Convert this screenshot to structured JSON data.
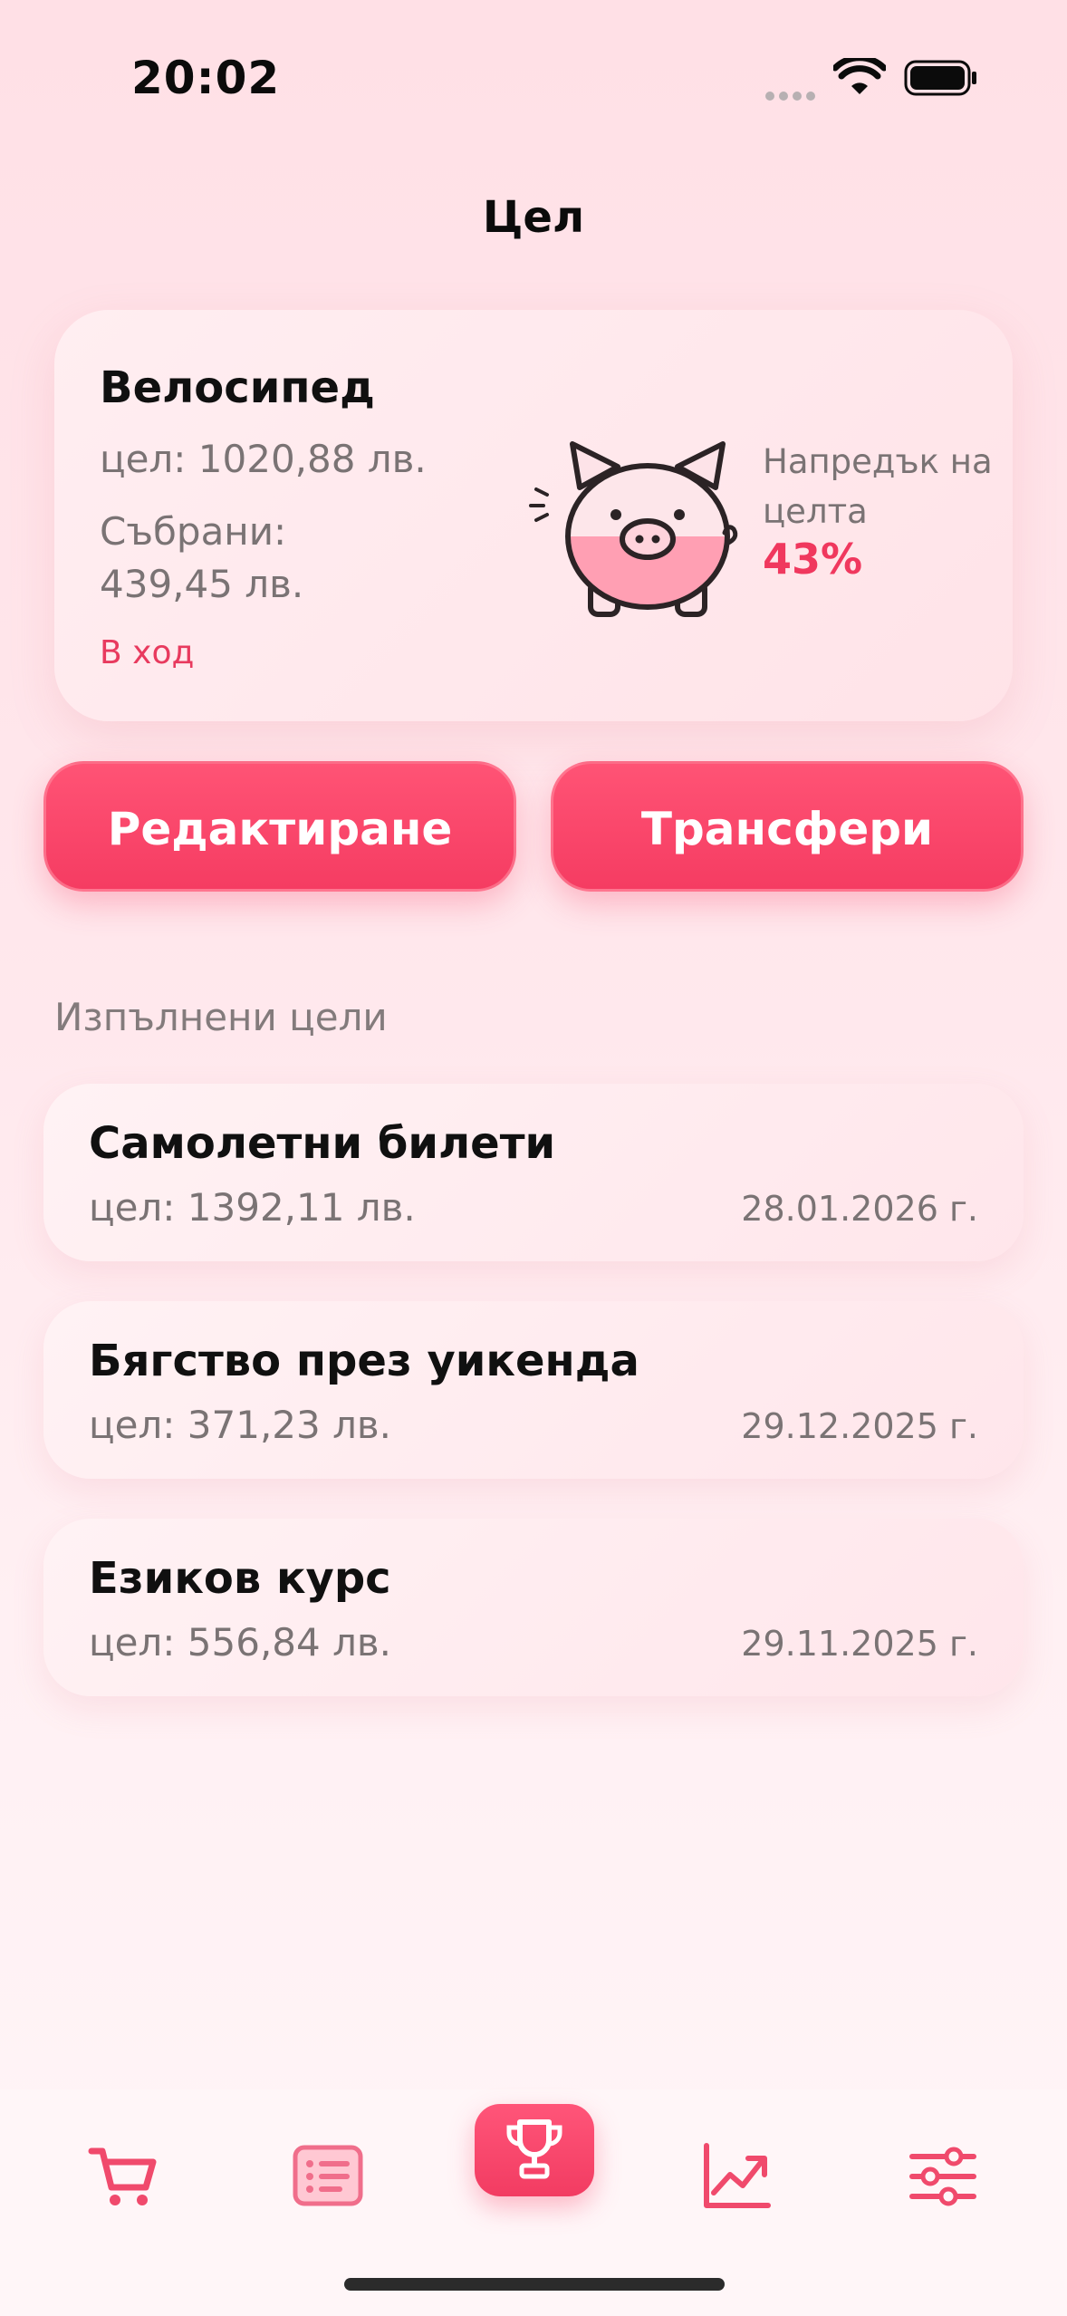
{
  "status_bar": {
    "time": "20:02"
  },
  "header": {
    "title": "Цел"
  },
  "current_goal": {
    "name": "Велосипед",
    "target": "цел: 1020,88 лв.",
    "collected_label": "Събрани:",
    "collected_value": "439,45 лв.",
    "status": "В ход",
    "progress_label": "Напредък на целта",
    "progress_value": "43%",
    "progress_fraction": 0.43
  },
  "actions": {
    "edit_label": "Редактиране",
    "transfers_label": "Трансфери"
  },
  "completed": {
    "section_title": "Изпълнени цели",
    "items": [
      {
        "name": "Самолетни билети",
        "target": "цел: 1392,11 лв.",
        "date": "28.01.2026 г."
      },
      {
        "name": "Бягство през уикенда",
        "target": "цел: 371,23 лв.",
        "date": "29.12.2025 г."
      },
      {
        "name": "Езиков курс",
        "target": "цел: 556,84 лв.",
        "date": "29.11.2025 г."
      }
    ]
  },
  "tab_bar": {
    "tabs": [
      {
        "icon": "cart-icon",
        "active": false
      },
      {
        "icon": "list-icon",
        "active": false
      },
      {
        "icon": "trophy-icon",
        "active": true
      },
      {
        "icon": "chart-icon",
        "active": false
      },
      {
        "icon": "sliders-icon",
        "active": false
      }
    ]
  },
  "colors": {
    "accent": "#f53c62",
    "accent_light": "#ff5375",
    "background": "#ffe7ec",
    "muted_text": "#7a7374"
  }
}
